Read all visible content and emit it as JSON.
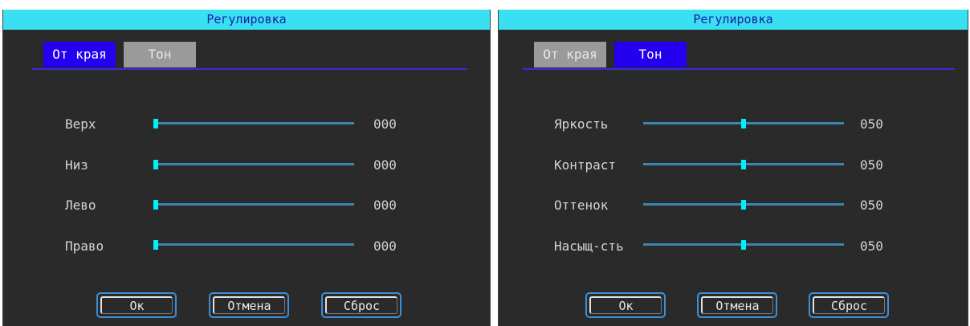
{
  "left_dialog": {
    "title": "Регулировка",
    "tabs": [
      {
        "label": "От края",
        "active": true
      },
      {
        "label": "Тон",
        "active": false
      }
    ],
    "rows": [
      {
        "label": "Верх",
        "value": "000",
        "level": 0
      },
      {
        "label": "Низ",
        "value": "000",
        "level": 0
      },
      {
        "label": "Лево",
        "value": "000",
        "level": 0
      },
      {
        "label": "Право",
        "value": "000",
        "level": 0
      }
    ],
    "buttons": {
      "ok": "Ок",
      "cancel": "Отмена",
      "reset": "Сброс"
    }
  },
  "right_dialog": {
    "title": "Регулировка",
    "tabs": [
      {
        "label": "От края",
        "active": false
      },
      {
        "label": "Тон",
        "active": true
      }
    ],
    "rows": [
      {
        "label": "Яркость",
        "value": "050",
        "level": 0.5
      },
      {
        "label": "Контраст",
        "value": "050",
        "level": 0.5
      },
      {
        "label": "Оттенок",
        "value": "050",
        "level": 0.5
      },
      {
        "label": "Насыщ-сть",
        "value": "050",
        "level": 0.5
      }
    ],
    "buttons": {
      "ok": "Ок",
      "cancel": "Отмена",
      "reset": "Сброс"
    }
  },
  "colors": {
    "title_bar": "#38e0f2",
    "title_text": "#1a1ab0",
    "active_tab": "#2400ee",
    "inactive_tab": "#9a9a9a",
    "panel_bg": "#2a2a2a",
    "slider_track": "#3b86b0",
    "slider_thumb": "#00f0f8",
    "button_border": "#3a8fd8"
  }
}
